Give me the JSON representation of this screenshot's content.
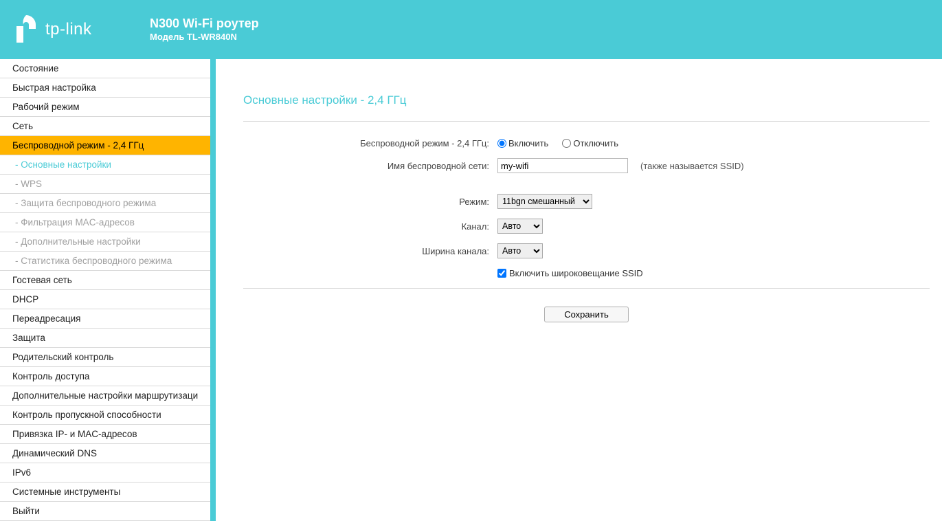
{
  "brand": "tp-link",
  "product": {
    "title": "N300 Wi-Fi роутер",
    "model": "Модель TL-WR840N"
  },
  "menu": {
    "status": "Состояние",
    "quick_setup": "Быстрая настройка",
    "op_mode": "Рабочий режим",
    "network": "Сеть",
    "wireless": "Беспроводной режим - 2,4 ГГц",
    "wireless_sub": {
      "basic": "- Основные настройки",
      "wps": "- WPS",
      "security": "- Защита беспроводного режима",
      "mac": "- Фильтрация MAC-адресов",
      "advanced": "- Дополнительные настройки",
      "stats": "- Статистика беспроводного режима"
    },
    "guest": "Гостевая сеть",
    "dhcp": "DHCP",
    "forwarding": "Переадресация",
    "security_m": "Защита",
    "parental": "Родительский контроль",
    "access": "Контроль доступа",
    "routing": "Дополнительные настройки маршрутизаци",
    "bandwidth": "Контроль пропускной способности",
    "ipmac": "Привязка IP- и MAC-адресов",
    "ddns": "Динамический DNS",
    "ipv6": "IPv6",
    "systools": "Системные инструменты",
    "logout": "Выйти"
  },
  "page": {
    "title": "Основные настройки - 2,4 ГГц",
    "labels": {
      "wireless_mode": "Беспроводной режим - 2,4 ГГц:",
      "enable": "Включить",
      "disable": "Отключить",
      "ssid": "Имя беспроводной сети:",
      "ssid_hint": "(также называется SSID)",
      "mode": "Режим:",
      "channel": "Канал:",
      "ch_width": "Ширина канала:",
      "bcast": "Включить широковещание SSID"
    },
    "values": {
      "ssid": "my-wifi",
      "mode": "11bgn смешанный",
      "channel": "Авто",
      "ch_width": "Авто"
    },
    "save": "Сохранить"
  }
}
